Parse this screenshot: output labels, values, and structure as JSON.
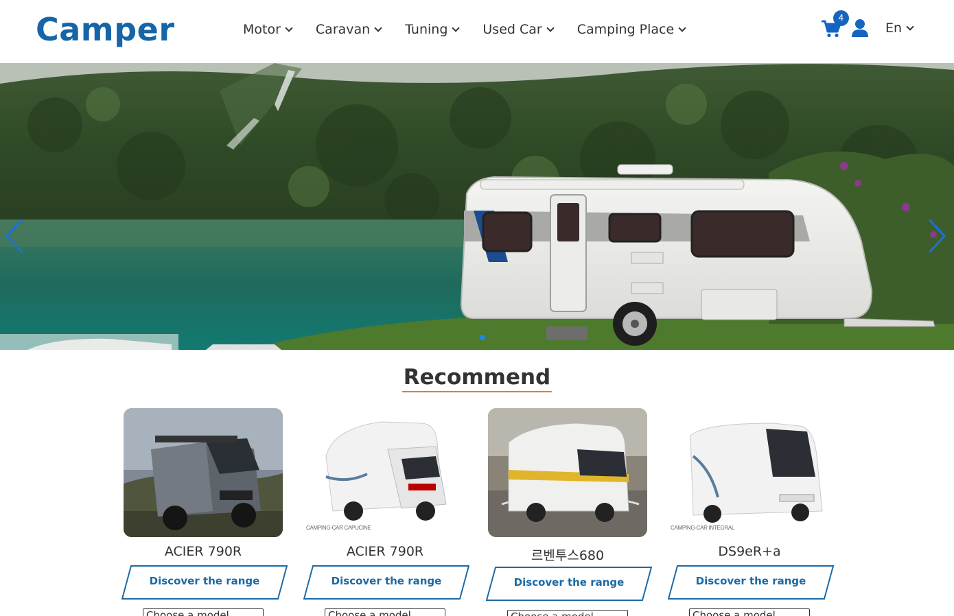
{
  "brand": {
    "logo_text": "Camper",
    "color": "#1565a8"
  },
  "nav": {
    "items": [
      {
        "label": "Motor"
      },
      {
        "label": "Caravan"
      },
      {
        "label": "Tuning"
      },
      {
        "label": "Used Car"
      },
      {
        "label": "Camping Place"
      }
    ]
  },
  "header_actions": {
    "cart_icon": "cart-icon",
    "cart_count": "4",
    "user_icon": "user-icon",
    "language": "En"
  },
  "hero": {
    "image": "caravan-by-lake-photo",
    "prev_icon": "chevron-left-icon",
    "next_icon": "chevron-right-icon",
    "active_slide_indicator": "dot"
  },
  "recommend": {
    "title": "Recommend",
    "accent_color": "#e67e22",
    "cards": [
      {
        "name": "ACIER 790R",
        "button": "Discover the range",
        "select": "Choose a model",
        "caption": ""
      },
      {
        "name": "ACIER 790R",
        "button": "Discover the range",
        "select": "Choose a model",
        "caption": "CAMPING-CAR CAPUCINE"
      },
      {
        "name": "르벤투스680",
        "button": "Discover the range",
        "select": "Choose a model",
        "caption": ""
      },
      {
        "name": "DS9eR+a",
        "button": "Discover the range",
        "select": "Choose a model",
        "caption": "CAMPING-CAR INTÉGRAL"
      }
    ]
  }
}
